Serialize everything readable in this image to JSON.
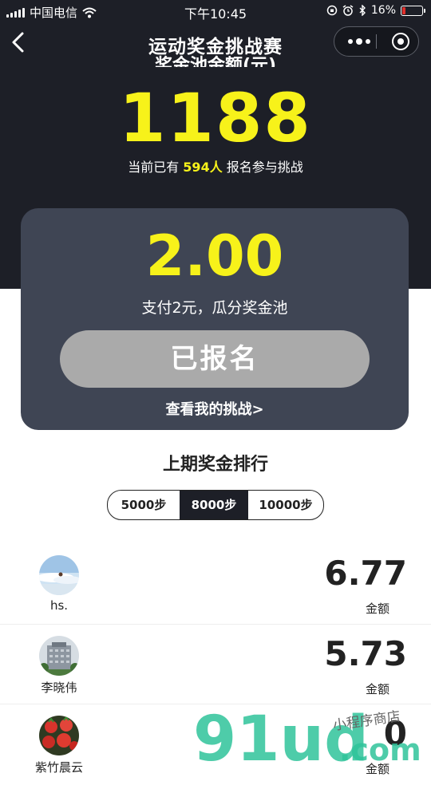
{
  "status_bar": {
    "carrier": "中国电信",
    "time": "下午10:45",
    "battery": "16%",
    "battery_level": 0.16,
    "battery_color": "#e0302c"
  },
  "nav": {
    "title": "运动奖金挑战赛",
    "back_icon": "chevron-left-icon",
    "more_icon": "more-dots-icon",
    "close_icon": "target-circle-icon"
  },
  "pool": {
    "label": "奖金池金额(元)",
    "amount": "1188",
    "participants_prefix": "当前已有",
    "participants_count": "594人",
    "participants_suffix": "报名参与挑战"
  },
  "entry": {
    "price": "2.00",
    "description": "支付2元，瓜分奖金池",
    "joined_label": "已报名",
    "my_challenge_link": "查看我的挑战>"
  },
  "ranking": {
    "title": "上期奖金排行",
    "tabs": [
      {
        "label": "5000步",
        "active": false
      },
      {
        "label": "8000步",
        "active": true
      },
      {
        "label": "10000步",
        "active": false
      }
    ],
    "rows": [
      {
        "name": "hs.",
        "amount": "6.77",
        "amount_label": "金额"
      },
      {
        "name": "李晓伟",
        "amount": "5.73",
        "amount_label": "金额"
      },
      {
        "name": "紫竹晨云",
        "amount": "0",
        "amount_label": "金额"
      }
    ]
  },
  "watermark": {
    "brand": "91ud",
    "domain": ".com",
    "tagline": "小程序商店"
  },
  "colors": {
    "header_bg": "#1d1f27",
    "card_bg": "#3f4554",
    "accent_yellow": "#f7f21a",
    "button_gray": "#aaaaaa",
    "watermark_green": "#2fc39a"
  }
}
